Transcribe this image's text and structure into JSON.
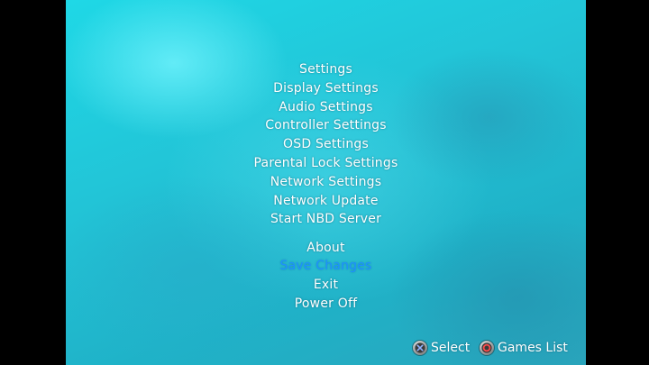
{
  "menu": {
    "items": [
      {
        "label": "Settings"
      },
      {
        "label": "Display Settings"
      },
      {
        "label": "Audio Settings"
      },
      {
        "label": "Controller Settings"
      },
      {
        "label": "OSD Settings"
      },
      {
        "label": "Parental Lock Settings"
      },
      {
        "label": "Network Settings"
      },
      {
        "label": "Network Update"
      },
      {
        "label": "Start NBD Server"
      }
    ],
    "secondary": [
      {
        "label": "About"
      },
      {
        "label": "Save Changes",
        "selected": true
      },
      {
        "label": "Exit"
      },
      {
        "label": "Power Off"
      }
    ]
  },
  "footer": {
    "select": {
      "label": "Select",
      "icon": "cross-button-icon"
    },
    "games": {
      "label": "Games List",
      "icon": "circle-button-icon"
    }
  },
  "colors": {
    "selected": "#1e90ff",
    "text": "#ffffff",
    "background": "#22c3d6"
  }
}
